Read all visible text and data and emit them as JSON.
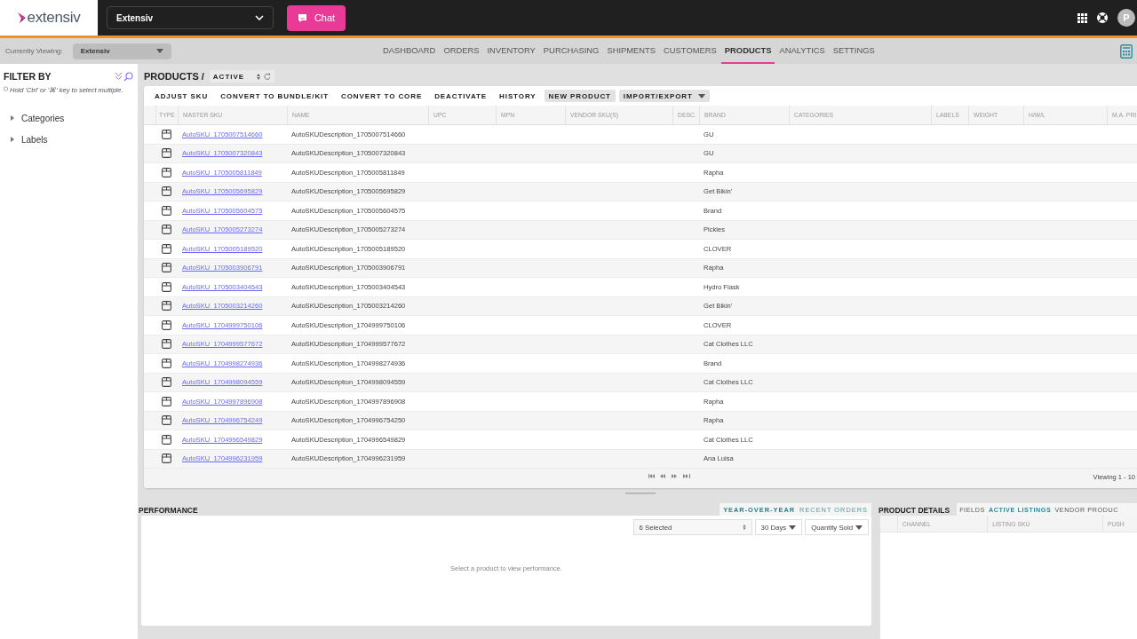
{
  "topbar": {
    "logo_text": "extensiv",
    "account": "Extensiv",
    "chat_button": "Chat",
    "avatar": "P"
  },
  "subnav": {
    "viewing_label": "Currently Viewing:",
    "viewing_value": "Extensiv",
    "nav": [
      {
        "label": "DASHBOARD",
        "selected": false
      },
      {
        "label": "ORDERS",
        "selected": false
      },
      {
        "label": "INVENTORY",
        "selected": false
      },
      {
        "label": "PURCHASING",
        "selected": false
      },
      {
        "label": "SHIPMENTS",
        "selected": false
      },
      {
        "label": "CUSTOMERS",
        "selected": false
      },
      {
        "label": "PRODUCTS",
        "selected": true
      },
      {
        "label": "ANALYTICS",
        "selected": false
      },
      {
        "label": "SETTINGS",
        "selected": false
      }
    ]
  },
  "sidebar": {
    "title": "FILTER BY",
    "hint": "Hold 'Ctrl' or '⌘' key to select multiple.",
    "items": [
      {
        "label": "Categories",
        "expanded": false
      },
      {
        "label": "Labels",
        "expanded": false
      }
    ]
  },
  "products": {
    "title": "PRODUCTS /",
    "status": "ACTIVE",
    "toolbar": [
      {
        "label": "ADJUST SKU",
        "kind": "text"
      },
      {
        "label": "CONVERT TO BUNDLE/KIT",
        "kind": "text"
      },
      {
        "label": "CONVERT TO CORE",
        "kind": "text"
      },
      {
        "label": "DEACTIVATE",
        "kind": "text"
      },
      {
        "label": "HISTORY",
        "kind": "text"
      },
      {
        "label": "NEW PRODUCT",
        "kind": "filled"
      },
      {
        "label": "IMPORT/EXPORT",
        "kind": "dropdown"
      }
    ],
    "columns": [
      "TYPE",
      "MASTER SKU",
      "NAME",
      "UPC",
      "MPN",
      "VENDOR SKU(S)",
      "DESC.",
      "BRAND",
      "CATEGORIES",
      "LABELS",
      "WEIGHT",
      "H/W/L",
      "M.A. PRI"
    ],
    "rows": [
      {
        "sku": "AutoSKU_1705007514660",
        "name": "AutoSKUDescription_1705007514660",
        "brand": "GU"
      },
      {
        "sku": "AutoSKU_1705007320843",
        "name": "AutoSKUDescription_1705007320843",
        "brand": "GU"
      },
      {
        "sku": "AutoSKU_1705005811849",
        "name": "AutoSKUDescription_1705005811849",
        "brand": "Rapha"
      },
      {
        "sku": "AutoSKU_1705005695829",
        "name": "AutoSKUDescription_1705005695829",
        "brand": "Get Bikin'"
      },
      {
        "sku": "AutoSKU_1705005604575",
        "name": "AutoSKUDescription_1705005604575",
        "brand": "Brand"
      },
      {
        "sku": "AutoSKU_1705005273274",
        "name": "AutoSKUDescription_1705005273274",
        "brand": "Pickles"
      },
      {
        "sku": "AutoSKU_1705005189520",
        "name": "AutoSKUDescription_1705005189520",
        "brand": "CLOVER"
      },
      {
        "sku": "AutoSKU_1705003906791",
        "name": "AutoSKUDescription_1705003906791",
        "brand": "Rapha"
      },
      {
        "sku": "AutoSKU_1705003404543",
        "name": "AutoSKUDescription_1705003404543",
        "brand": "Hydro Flask"
      },
      {
        "sku": "AutoSKU_1705003214260",
        "name": "AutoSKUDescription_1705003214260",
        "brand": "Get Bikin'"
      },
      {
        "sku": "AutoSKU_1704999750106",
        "name": "AutoSKUDescription_1704999750106",
        "brand": "CLOVER"
      },
      {
        "sku": "AutoSKU_1704999577672",
        "name": "AutoSKUDescription_1704999577672",
        "brand": "Cat Clothes LLC"
      },
      {
        "sku": "AutoSKU_1704998274936",
        "name": "AutoSKUDescription_1704998274936",
        "brand": "Brand"
      },
      {
        "sku": "AutoSKU_1704998094559",
        "name": "AutoSKUDescription_1704998094559",
        "brand": "Cat Clothes LLC"
      },
      {
        "sku": "AutoSKU_1704997896908",
        "name": "AutoSKUDescription_1704997896908",
        "brand": "Rapha"
      },
      {
        "sku": "AutoSKU_1704996754249",
        "name": "AutoSKUDescription_1704996754250",
        "brand": "Rapha"
      },
      {
        "sku": "AutoSKU_1704996549829",
        "name": "AutoSKUDescription_1704996549829",
        "brand": "Cat Clothes LLC"
      },
      {
        "sku": "AutoSKU_1704996231959",
        "name": "AutoSKUDescription_1704996231959",
        "brand": "Ana Luisa"
      }
    ],
    "viewing": "Viewing 1 - 10"
  },
  "performance": {
    "title": "PERFORMANCE",
    "tabs": [
      {
        "label": "YEAR-OVER-YEAR",
        "selected": true
      },
      {
        "label": "RECENT ORDERS",
        "selected": false
      }
    ],
    "filters": [
      {
        "label": "6 Selected",
        "kind": "select"
      },
      {
        "label": "30 Days",
        "kind": "dropdown"
      },
      {
        "label": "Quantity Sold",
        "kind": "dropdown"
      }
    ],
    "empty_message": "Select a product to view performance."
  },
  "product_details": {
    "title": "PRODUCT DETAILS",
    "tabs": [
      {
        "label": "FIELDS",
        "selected": false
      },
      {
        "label": "ACTIVE LISTINGS",
        "selected": true
      },
      {
        "label": "VENDOR PRODUC",
        "selected": false
      }
    ],
    "columns": [
      "CHANNEL",
      "LISTING SKU",
      "PUSH"
    ]
  }
}
